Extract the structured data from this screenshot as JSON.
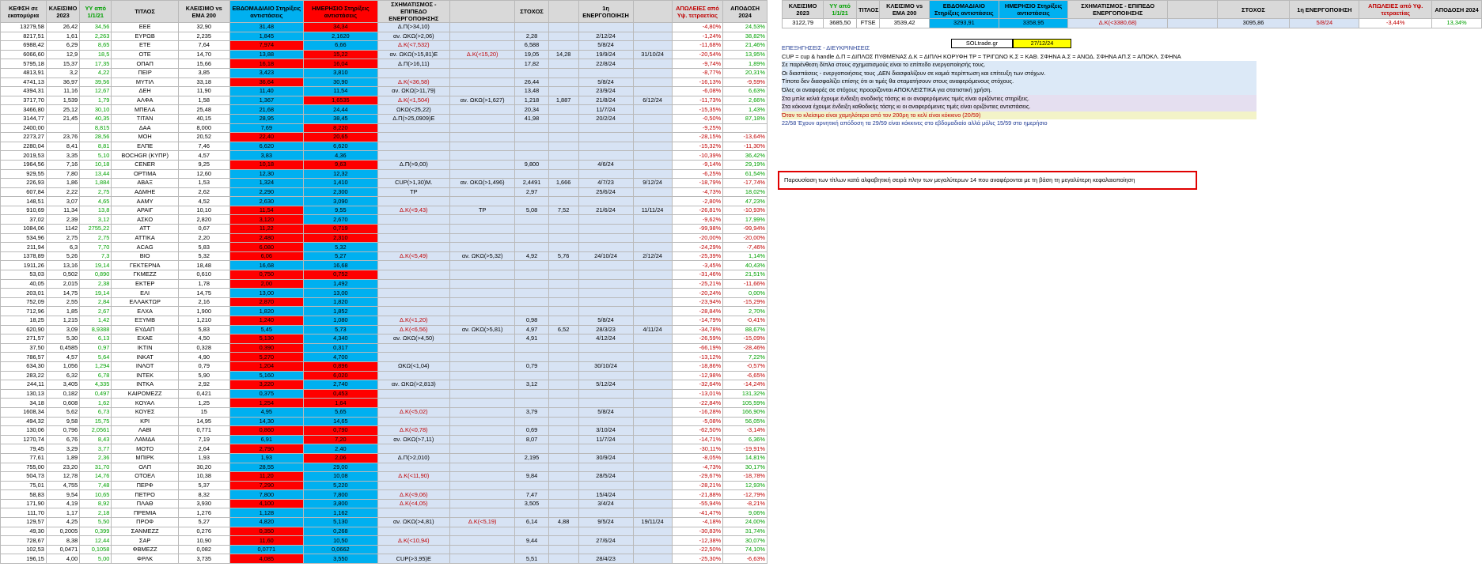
{
  "colors": {
    "header_bg": "#d9d9d9",
    "support_blue": "#00b0f0",
    "resistance_red": "#ff0000",
    "light_blue": "#d7e3f4",
    "red_text": "#c00000",
    "green_text": "#00a000",
    "note_border": "#e00000"
  },
  "headers": [
    "ΚΕΦΣΗ σε εκατομύρια",
    "ΚΛΕΙΣΙΜΟ 2023",
    "ΥΥ από 1/1/21",
    "ΤΙΤΛΟΣ",
    "ΚΛΕΙΣΙΜΟ vs EMA 200",
    "ΕΒΔΟΜΑΔΙΑΙΟ Στηρίξεις αντιστάσεις",
    "ΗΜΕΡΗΣΙΟ Στηρίξεις αντιστάσεις",
    "ΣΧΗΜΑΤΙΣΜΟΣ - ΕΠΙΠΕΔΟ ΕΝΕΡΓΟΠΟΙΗΣΗΣ",
    "",
    "ΣΤΟΧΟΣ",
    "",
    "1η ΕΝΕΡΓΟΠΟΙΗΣΗ",
    "",
    "ΑΠΩΛΕΙΕΣ από Υψ. τετραετίας",
    "ΑΠΟΔΟΣΗ 2024"
  ],
  "rows": [
    [
      "13279,58",
      "26,42",
      "34,56",
      "ΕΕΕ",
      "32,90",
      "31,48",
      "34,34",
      "Δ.Π(>34,10)",
      "",
      "",
      "",
      "",
      "",
      "-4,80%",
      "24,53%"
    ],
    [
      "8217,51",
      "1,61",
      "2,263",
      "ΕΥΡΩΒ",
      "2,235",
      "1,845",
      "2,1620",
      "αν. ΩΚΩ(>2,06)",
      "",
      "2,28",
      "",
      "2/12/24",
      "",
      "-1,24%",
      "38,82%"
    ],
    [
      "6988,42",
      "6,29",
      "8,65",
      "ΕΤΕ",
      "7,64",
      "7,974",
      "6,66",
      "Δ.Κ(<7,532)",
      "",
      "6,588",
      "",
      "5/8/24",
      "",
      "-11,68%",
      "21,46%"
    ],
    [
      "6066,60",
      "12,9",
      "18,5",
      "ΟΤΕ",
      "14,70",
      "13,88",
      "15,22",
      "αν. ΩΚΩ(>15,81)Ε",
      "Δ.Κ(<15,20)",
      "19,05",
      "14,28",
      "19/9/24",
      "31/10/24",
      "-20,54%",
      "13,95%"
    ],
    [
      "5795,18",
      "15,37",
      "17,35",
      "ΟΠΑΠ",
      "15,66",
      "16,18",
      "16,04",
      "Δ.Π(>16,11)",
      "",
      "17,82",
      "",
      "22/8/24",
      "",
      "-9,74%",
      "1,89%"
    ],
    [
      "4813,91",
      "3,2",
      "4,22",
      "ΠΕΙΡ",
      "3,85",
      "3,423",
      "3,810",
      "",
      "",
      "",
      "",
      "",
      "",
      "-8,77%",
      "20,31%"
    ],
    [
      "4741,13",
      "36,97",
      "39,56",
      "ΜΥΤΙΛ",
      "33,18",
      "36,64",
      "30,90",
      "Δ.Κ(<36,58)",
      "",
      "26,44",
      "",
      "5/8/24",
      "",
      "-16,13%",
      "-9,59%"
    ],
    [
      "4394,31",
      "11,16",
      "12,67",
      "ΔΕΗ",
      "11,90",
      "11,40",
      "11,54",
      "αν. ΩΚΩ(>11,79)",
      "",
      "13,48",
      "",
      "23/9/24",
      "",
      "-6,08%",
      "6,63%"
    ],
    [
      "3717,70",
      "1,539",
      "1,79",
      "ΑΛΦΑ",
      "1,58",
      "1,367",
      "1,6535",
      "Δ.Κ(<1,504)",
      "αν. ΩΚΩ(>1,627)",
      "1,218",
      "1,887",
      "21/8/24",
      "6/12/24",
      "-11,73%",
      "2,66%"
    ],
    [
      "3466,80",
      "25,12",
      "30,10",
      "ΜΠΕΛΑ",
      "25,48",
      "21,68",
      "24,44",
      "ΩΚΩ(<25,22)",
      "",
      "20,34",
      "",
      "11/7/24",
      "",
      "-15,35%",
      "1,43%"
    ],
    [
      "3144,77",
      "21,45",
      "40,35",
      "ΤΙΤΑΝ",
      "40,15",
      "28,95",
      "38,45",
      "Δ.Π(>25,0909)Ε",
      "",
      "41,98",
      "",
      "20/2/24",
      "",
      "-0,50%",
      "87,18%"
    ],
    [
      "2400,00",
      "",
      "8,815",
      "ΔΑΑ",
      "8,000",
      "7,69",
      "8,220",
      "",
      "",
      "",
      "",
      "",
      "",
      "-9,25%",
      ""
    ],
    [
      "2273,27",
      "23,76",
      "28,56",
      "ΜΟΗ",
      "20,52",
      "22,40",
      "20,65",
      "",
      "",
      "",
      "",
      "",
      "",
      "-28,15%",
      "-13,64%"
    ],
    [
      "2280,04",
      "8,41",
      "8,81",
      "ΕΛΠΕ",
      "7,46",
      "6,620",
      "6,620",
      "",
      "",
      "",
      "",
      "",
      "",
      "-15,32%",
      "-11,30%"
    ],
    [
      "2019,53",
      "3,35",
      "5,10",
      "BOCHGR (ΚΥΠΡ)",
      "4,57",
      "3,83",
      "4,36",
      "",
      "",
      "",
      "",
      "",
      "",
      "-10,39%",
      "36,42%"
    ],
    [
      "1964,56",
      "7,16",
      "10,18",
      "CENER",
      "9,25",
      "10,18",
      "9,63",
      "Δ.Π(>9,00)",
      "",
      "9,800",
      "",
      "4/6/24",
      "",
      "-9,14%",
      "29,19%"
    ],
    [
      "929,55",
      "7,80",
      "13,44",
      "OPTIMA",
      "12,60",
      "12,30",
      "12,32",
      "",
      "",
      "",
      "",
      "",
      "",
      "-6,25%",
      "61,54%"
    ],
    [
      "226,93",
      "1,86",
      "1,884",
      "ΑΒΑΞ",
      "1,53",
      "1,324",
      "1,410",
      "CUP(>1,30)Μ.",
      "αν. ΩΚΩ(>1,496)",
      "2,4491",
      "1,666",
      "4/7/23",
      "9/12/24",
      "-18,79%",
      "-17,74%"
    ],
    [
      "607,84",
      "2,22",
      "2,75",
      "ΑΔΜΗΕ",
      "2,62",
      "2,290",
      "2,300",
      "TP",
      "",
      "2,97",
      "",
      "25/6/24",
      "",
      "-4,73%",
      "18,02%"
    ],
    [
      "148,51",
      "3,07",
      "4,65",
      "ΑΑΜΥ",
      "4,52",
      "2,630",
      "3,090",
      "",
      "",
      "",
      "",
      "",
      "",
      "-2,80%",
      "47,23%"
    ],
    [
      "910,69",
      "11,34",
      "13,8",
      "ΑΡΑΙΓ",
      "10,10",
      "11,54",
      "9,55",
      "Δ.Κ(<9,43)",
      "TP",
      "5,08",
      "7,52",
      "21/6/24",
      "11/11/24",
      "-26,81%",
      "-10,93%"
    ],
    [
      "37,02",
      "2,39",
      "3,12",
      "ΑΣΚΟ",
      "2,820",
      "3,120",
      "2,670",
      "",
      "",
      "",
      "",
      "",
      "",
      "-9,62%",
      "17,99%"
    ],
    [
      "1084,06",
      "1142",
      "2755,22",
      "ΑΤΤ",
      "0,67",
      "11,22",
      "0,719",
      "",
      "",
      "",
      "",
      "",
      "",
      "-99,98%",
      "-99,94%"
    ],
    [
      "534,96",
      "2,75",
      "2,75",
      "ΑΤΤΙΚΑ",
      "2,20",
      "2,480",
      "2,310",
      "",
      "",
      "",
      "",
      "",
      "",
      "-20,00%",
      "-20,00%"
    ],
    [
      "211,94",
      "6,3",
      "7,70",
      "ACAG",
      "5,83",
      "6,080",
      "5,32",
      "",
      "",
      "",
      "",
      "",
      "",
      "-24,29%",
      "-7,46%"
    ],
    [
      "1378,89",
      "5,26",
      "7,3",
      "ΒΙΟ",
      "5,32",
      "6,06",
      "5,27",
      "Δ.Κ(<5,49)",
      "αν. ΩΚΩ(>5,32)",
      "4,92",
      "5,76",
      "24/10/24",
      "2/12/24",
      "-25,39%",
      "1,14%"
    ],
    [
      "1911,26",
      "13,16",
      "19,14",
      "ΓΕΚΤΕΡΝΑ",
      "18,48",
      "16,68",
      "16,68",
      "",
      "",
      "",
      "",
      "",
      "",
      "-3,45%",
      "40,43%"
    ],
    [
      "53,03",
      "0,502",
      "0,890",
      "ΓΚΜΕΖΖ",
      "0,610",
      "0,750",
      "0,752",
      "",
      "",
      "",
      "",
      "",
      "",
      "-31,46%",
      "21,51%"
    ],
    [
      "40,05",
      "2,015",
      "2,38",
      "ΕΚΤΕΡ",
      "1,78",
      "2,00",
      "1,492",
      "",
      "",
      "",
      "",
      "",
      "",
      "-25,21%",
      "-11,66%"
    ],
    [
      "203,01",
      "14,75",
      "19,14",
      "ΕΛΙ",
      "14,75",
      "13,00",
      "13,00",
      "",
      "",
      "",
      "",
      "",
      "",
      "-20,24%",
      "0,00%"
    ],
    [
      "752,09",
      "2,55",
      "2,84",
      "ΕΛΛΑΚΤΩΡ",
      "2,16",
      "2,870",
      "1,820",
      "",
      "",
      "",
      "",
      "",
      "",
      "-23,94%",
      "-15,29%"
    ],
    [
      "712,96",
      "1,85",
      "2,67",
      "ΕΛΧΑ",
      "1,900",
      "1,820",
      "1,852",
      "",
      "",
      "",
      "",
      "",
      "",
      "-28,84%",
      "2,70%"
    ],
    [
      "18,25",
      "1,215",
      "1,42",
      "ΕΞΥΜΒ",
      "1,210",
      "1,240",
      "1,080",
      "Δ.Κ(<1,20)",
      "",
      "0,98",
      "",
      "5/8/24",
      "",
      "-14,79%",
      "-0,41%"
    ],
    [
      "620,90",
      "3,09",
      "8,9388",
      "ΕΥΔΑΠ",
      "5,83",
      "5,45",
      "5,73",
      "Δ.Κ(<6,56)",
      "αν. ΩΚΩ(>5,81)",
      "4,97",
      "6,52",
      "28/3/23",
      "4/11/24",
      "-34,78%",
      "88,67%"
    ],
    [
      "271,57",
      "5,30",
      "6,13",
      "ΕΧΑΕ",
      "4,50",
      "5,130",
      "4,340",
      "αν. ΩΚΩ(>4,50)",
      "",
      "4,91",
      "",
      "4/12/24",
      "",
      "-26,59%",
      "-15,09%"
    ],
    [
      "37,50",
      "0,4585",
      "0,97",
      "ΙΚΤΙΝ",
      "0,328",
      "0,390",
      "0,317",
      "",
      "",
      "",
      "",
      "",
      "",
      "-66,19%",
      "-28,46%"
    ],
    [
      "786,57",
      "4,57",
      "5,64",
      "ΙΝΚΑΤ",
      "4,90",
      "5,270",
      "4,700",
      "",
      "",
      "",
      "",
      "",
      "",
      "-13,12%",
      "7,22%"
    ],
    [
      "634,30",
      "1,056",
      "1,294",
      "ΙΝΛΟΤ",
      "0,79",
      "1,204",
      "0,896",
      "ΩΚΩ(<1,04)",
      "",
      "0,79",
      "",
      "30/10/24",
      "",
      "-18,86%",
      "-0,57%"
    ],
    [
      "283,22",
      "6,32",
      "6,78",
      "ΙΝΤΕΚ",
      "5,90",
      "5,160",
      "6,020",
      "",
      "",
      "",
      "",
      "",
      "",
      "-12,98%",
      "-6,65%"
    ],
    [
      "244,11",
      "3,405",
      "4,335",
      "ΙΝΤΚΑ",
      "2,92",
      "3,220",
      "2,740",
      "αν. ΩΚΩ(>2,813)",
      "",
      "3,12",
      "",
      "5/12/24",
      "",
      "-32,64%",
      "-14,24%"
    ],
    [
      "130,13",
      "0,182",
      "0,497",
      "ΚΑΙΡΟΜΕΖΖ",
      "0,421",
      "0,375",
      "0,453",
      "",
      "",
      "",
      "",
      "",
      "",
      "-13,01%",
      "131,32%"
    ],
    [
      "34,18",
      "0,608",
      "1,62",
      "ΚΟΥΑΛ",
      "1,25",
      "1,254",
      "1,64",
      "",
      "",
      "",
      "",
      "",
      "",
      "-22,84%",
      "105,59%"
    ],
    [
      "1608,34",
      "5,62",
      "6,73",
      "ΚΟΥΕΣ",
      "15",
      "4,95",
      "5,65",
      "Δ.Κ(<5,02)",
      "",
      "3,79",
      "",
      "5/8/24",
      "",
      "-16,28%",
      "166,90%"
    ],
    [
      "494,32",
      "9,58",
      "15,75",
      "ΚΡΙ",
      "14,95",
      "14,30",
      "14,65",
      "",
      "",
      "",
      "",
      "",
      "",
      "-5,08%",
      "56,05%"
    ],
    [
      "130,06",
      "0,796",
      "2,0561",
      "ΛΑΒΙ",
      "0,771",
      "0,860",
      "0,790",
      "Δ.Κ(<0,78)",
      "",
      "0,69",
      "",
      "3/10/24",
      "",
      "-62,50%",
      "-3,14%"
    ],
    [
      "1270,74",
      "6,76",
      "8,43",
      "ΛΑΜΔΑ",
      "7,19",
      "6,91",
      "7,20",
      "αν. ΩΚΩ(>7,11)",
      "",
      "8,07",
      "",
      "11/7/24",
      "",
      "-14,71%",
      "6,36%"
    ],
    [
      "79,45",
      "3,29",
      "3,77",
      "ΜΟΤΟ",
      "2,64",
      "2,790",
      "2,40",
      "",
      "",
      "",
      "",
      "",
      "",
      "-30,11%",
      "-19,91%"
    ],
    [
      "77,61",
      "1,89",
      "2,36",
      "ΜΠΙΡΚ",
      "1,93",
      "1,93",
      "2,06",
      "Δ.Π(>2,010)",
      "",
      "2,195",
      "",
      "30/9/24",
      "",
      "-8,05%",
      "14,81%"
    ],
    [
      "755,00",
      "23,20",
      "31,70",
      "ΟΛΠ",
      "30,20",
      "28,55",
      "29,00",
      "",
      "",
      "",
      "",
      "",
      "",
      "-4,73%",
      "30,17%"
    ],
    [
      "504,73",
      "12,78",
      "14,76",
      "ΟΤΟΕΛ",
      "10,38",
      "11,20",
      "10,08",
      "Δ.Κ(<11,90)",
      "",
      "9,84",
      "",
      "28/5/24",
      "",
      "-29,67%",
      "-18,78%"
    ],
    [
      "75,01",
      "4,755",
      "7,48",
      "ΠΕΡΦ",
      "5,37",
      "7,290",
      "5,220",
      "",
      "",
      "",
      "",
      "",
      "",
      "-28,21%",
      "12,93%"
    ],
    [
      "58,83",
      "9,54",
      "10,65",
      "ΠΕΤΡΟ",
      "8,32",
      "7,800",
      "7,800",
      "Δ.Κ(<9,06)",
      "",
      "7,47",
      "",
      "15/4/24",
      "",
      "-21,88%",
      "-12,79%"
    ],
    [
      "171,90",
      "4,19",
      "8,92",
      "ΠΛΑΘ",
      "3,930",
      "4,100",
      "3,800",
      "Δ.Κ(<4,05)",
      "",
      "3,505",
      "",
      "3/4/24",
      "",
      "-55,94%",
      "-8,21%"
    ],
    [
      "111,70",
      "1,17",
      "2,18",
      "ΠΡΕΜΙΑ",
      "1,276",
      "1,128",
      "1,162",
      "",
      "",
      "",
      "",
      "",
      "",
      "-41,47%",
      "9,06%"
    ],
    [
      "129,57",
      "4,25",
      "5,50",
      "ΠΡΟΦ",
      "5,27",
      "4,820",
      "5,130",
      "αν. ΩΚΩ(>4,81)",
      "Δ.Κ(<5,19)",
      "6,14",
      "4,88",
      "9/5/24",
      "19/11/24",
      "-4,18%",
      "24,00%"
    ],
    [
      "49,30",
      "0,2005",
      "0,399",
      "ΣΑΝΜΕΖΖ",
      "0,276",
      "0,350",
      "0,268",
      "",
      "",
      "",
      "",
      "",
      "",
      "-30,83%",
      "31,74%"
    ],
    [
      "728,67",
      "8,38",
      "12,44",
      "ΣΑΡ",
      "10,90",
      "11,60",
      "10,50",
      "Δ.Κ(<10,94)",
      "",
      "9,44",
      "",
      "27/6/24",
      "",
      "-12,38%",
      "30,07%"
    ],
    [
      "102,53",
      "0,0471",
      "0,1058",
      "ΦΒΜΕΖΖ",
      "0,082",
      "0,0771",
      "0,0662",
      "",
      "",
      "",
      "",
      "",
      "",
      "-22,50%",
      "74,10%"
    ],
    [
      "196,15",
      "4,00",
      "5,00",
      "ΦΡΛΚ",
      "3,735",
      "4,085",
      "3,550",
      "CUP(>3,95)Ε",
      "",
      "5,51",
      "",
      "28/4/23",
      "",
      "-25,30%",
      "-6,63%"
    ]
  ],
  "right": {
    "headers": [
      "ΚΛΕΙΣΙΜΟ 2023",
      "ΥΥ από 1/1/21",
      "ΤΙΤΛΟΣ",
      "ΚΛΕΙΣΙΜΟ vs EMA 200",
      "ΕΒΔΟΜΑΔΙΑΙΟ Στηρίξεις αντιστάσεις",
      "ΗΜΕΡΗΣΙΟ Στηρίξεις αντιστάσεις",
      "ΣΧΗΜΑΤΙΣΜΟΣ - ΕΠΙΠΕΔΟ ΕΝΕΡΓΟΠΟΙΗΣΗΣ",
      "",
      "ΣΤΟΧΟΣ",
      "1η ΕΝΕΡΓΟΠΟΙΗΣΗ",
      "ΑΠΩΛΕΙΕΣ από Υψ. τετραετίας",
      "ΑΠΟΔΟΣΗ 2024"
    ],
    "row": [
      "3122,79",
      "3685,50",
      "FTSE",
      "3539,42",
      "3293,91",
      "3358,95",
      "Δ.Κ(<3380,68)",
      "",
      "3095,86",
      "5/8/24",
      "-3,44%",
      "13,34%"
    ]
  },
  "sol_label": "SOLtrade.gr",
  "sol_date": "27/12/24",
  "legend": [
    {
      "text": "ΕΠΕΞΗΓΗΣΕΙΣ - ΔΙΕΥΚΡΙΝΗΣΕΙΣ",
      "cls": "tb"
    },
    {
      "text": "CUP = cup & handle   Δ.Π = ΔΙΠΛΟΣ ΠΥΘΜΕΝΑΣ  Δ.Κ = ΔΙΠΛΗ ΚΟΡΥΦΗ ΤΡ = ΤΡΙΓΩΝΟ  Κ.Σ = ΚΑΘ. ΣΦΗΝΑ  Α.Σ = ΑΝΟΔ. ΣΦΗΝΑ  ΑΠ.Σ = ΑΠΟΚΛ. ΣΦΗΝΑ",
      "cls": ""
    },
    {
      "text": "Σε παρένθεση δίπλα στους σχηματισμούς είναι το επίπεδο ενεργοποίησής τους.",
      "cls": "lb"
    },
    {
      "text": "Οι διασπάσεις - ενεργοποιήσεις τους ,ΔΕΝ διασφαλίζουν σε καμιά περίπτωση και επίτευξη των στόχων.",
      "cls": "lb"
    },
    {
      "text": "Τίποτα δεν διασφαλίζει επίσης ότι οι τιμές θα σταματήσουν στους αναφερόμενους στόχους.",
      "cls": "lb"
    },
    {
      "text": "Όλες οι αναφορές σε στόχους προορίζονται ΑΠΟΚΛΕΙΣΤΙΚΑ για  στατιστική χρήση.",
      "cls": "lb"
    },
    {
      "text": "Στα μπλε κελιά έχουμε ένδειξη ανοδικής τάσης κι οι αναφερόμενες τιμές είναι οριζόντιες στηρίξεις.",
      "cls": "lp"
    },
    {
      "text": "Στα κόκκινα έχουμε ένδειξη καθοδικής τάσης κι οι αναφερόμενες τιμές είναι οριζόντιες αντιστάσεις.",
      "cls": "lp"
    },
    {
      "text": "Όταν το κλείσιμο είναι χαμηλότερα από τον 200ρη το κελί είναι κόκκινο (20/59)",
      "cls": "ly lr"
    },
    {
      "text": "22/58 Έχουν αρνητική απόδοση τα 29/59 είναι κόκκινες στο εβδομαδιαίο αλλά μόλις 15/59 στο ημερήσιο",
      "cls": "tb"
    }
  ],
  "note": "Παρουσίαση των τίτλων κατά αλφαβητική σειρά πλην των μεγαλύτερων 14 που αναφέρονται με τη βάση τη μεγαλύτερη κεφαλαιοποίηση"
}
